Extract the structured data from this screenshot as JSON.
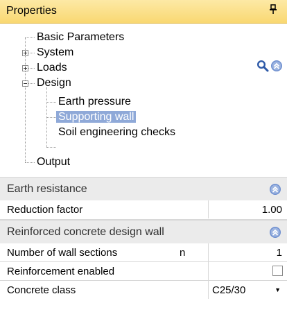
{
  "panel": {
    "title": "Properties",
    "pin_glyph": "▄"
  },
  "tree": {
    "items": [
      {
        "label": "Basic Parameters"
      },
      {
        "label": "System"
      },
      {
        "label": "Loads"
      },
      {
        "label": "Design"
      },
      {
        "label": "Earth pressure"
      },
      {
        "label": "Supporting wall",
        "selected": true
      },
      {
        "label": "Soil engineering checks"
      },
      {
        "label": "Output"
      }
    ]
  },
  "sections": {
    "earth_resistance": {
      "title": "Earth resistance",
      "rows": [
        {
          "name": "Reduction factor",
          "value": "1.00"
        }
      ]
    },
    "reinforced_concrete": {
      "title": "Reinforced concrete design wall",
      "rows": [
        {
          "name": "Number of wall sections",
          "symbol": "n",
          "value": "1"
        },
        {
          "name": "Reinforcement enabled",
          "checked": false
        },
        {
          "name": "Concrete class",
          "value": "C25/30"
        }
      ]
    }
  },
  "colors": {
    "title_bar": "#f9d872",
    "selection": "#8fa9d8",
    "section_bg": "#ebebeb",
    "icon_blue": "#4a6fb4"
  },
  "icons": [
    "pin-icon",
    "search-icon",
    "collapse-icon",
    "expand-plus-icon",
    "collapse-minus-icon",
    "dropdown-arrow-icon"
  ]
}
